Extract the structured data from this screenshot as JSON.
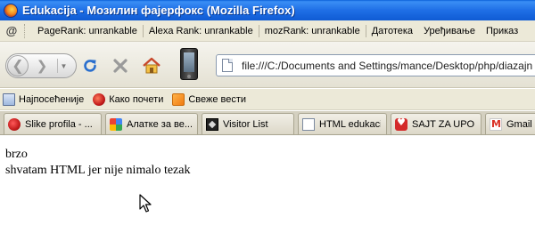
{
  "window": {
    "title": "Edukacija - Мозилин фајерфокс (Mozilla Firefox)"
  },
  "infobar": {
    "pagerank": "PageRank: unrankable",
    "alexa": "Alexa Rank: unrankable",
    "mozrank": "mozRank: unrankable",
    "menus": [
      "Датотека",
      "Уређивање",
      "Приказ"
    ]
  },
  "navbar": {
    "url": "file:///C:/Documents and Settings/mance/Desktop/php/diazajn za nov"
  },
  "bookmarks": [
    {
      "label": "Најпосећеније",
      "icon": "bookmark-icon"
    },
    {
      "label": "Како почети",
      "icon": "getting-started-icon"
    },
    {
      "label": "Свеже вести",
      "icon": "rss-icon"
    }
  ],
  "tabs": [
    {
      "label": "Slike profila - ...",
      "icon": "red-flower-icon",
      "active": false
    },
    {
      "label": "Алатке за ве...",
      "icon": "google-icon",
      "active": false
    },
    {
      "label": "Visitor List",
      "icon": "film-icon",
      "active": false
    },
    {
      "label": "HTML edukacija",
      "icon": "page-icon",
      "active": false
    },
    {
      "label": "SAJT ZA UPO...",
      "icon": "heart-icon",
      "active": false
    },
    {
      "label": "Gmail",
      "icon": "gmail-icon",
      "active": false
    }
  ],
  "content": {
    "line1": "brzo",
    "line2": "shvatam HTML jer nije nimalo tezak"
  },
  "colors": {
    "titlebar": "#1f6fe6",
    "chrome": "#ece9d8"
  }
}
